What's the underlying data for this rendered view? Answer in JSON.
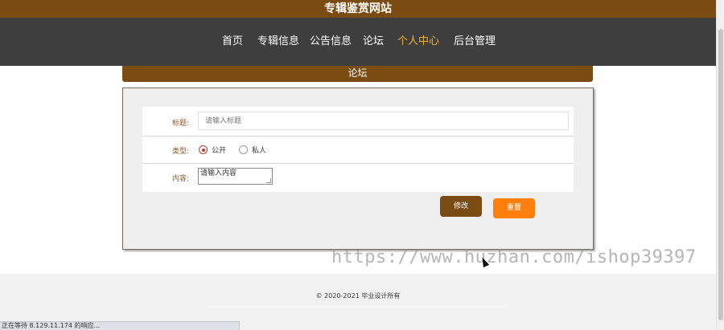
{
  "site": {
    "title": "专辑鉴赏网站"
  },
  "nav": {
    "items": [
      {
        "label": "首页"
      },
      {
        "label": "专辑信息"
      },
      {
        "label": "公告信息"
      },
      {
        "label": "论坛"
      },
      {
        "label": "个人中心",
        "active": true
      },
      {
        "label": "后台管理"
      }
    ]
  },
  "section": {
    "title": "论坛"
  },
  "form": {
    "title_label": "标题:",
    "title_placeholder": "请输入标题",
    "type_label": "类型:",
    "type_options": [
      {
        "label": "公开",
        "checked": true
      },
      {
        "label": "私人",
        "checked": false
      }
    ],
    "content_label": "内容:",
    "content_placeholder": "请输入内容",
    "edit_button": "修改",
    "reset_button": "重置"
  },
  "footer": {
    "copyright": "© 2020-2021 毕业设计所有"
  },
  "watermark": {
    "text": "https://www.huzhan.com/ishop39397"
  },
  "status_bar": {
    "text": "正在等待 8.129.11.174 的响应..."
  },
  "colors": {
    "brand_brown": "#7a4c13",
    "nav_dark": "#3e3e3e",
    "nav_active": "#f0b428",
    "reset_orange": "#ff7f0e",
    "radio_checked": "#c0392b"
  }
}
